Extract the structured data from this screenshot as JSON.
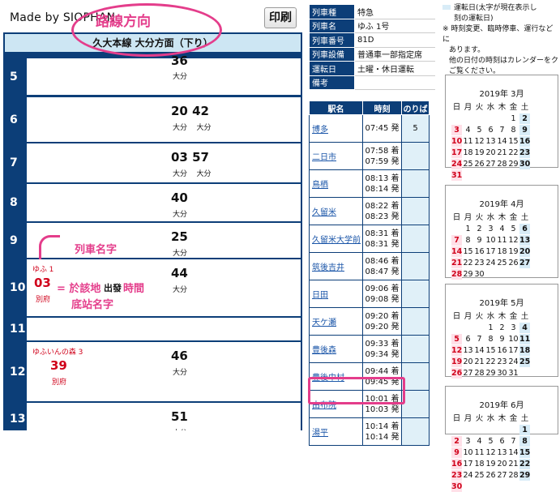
{
  "header": {
    "madeby": "Made by SIOPHAN",
    "print_label": "印刷",
    "annotation_title": "路線方向"
  },
  "timetable": {
    "title": "久大本線 大分方面（下り）",
    "rows": [
      {
        "hour": "5",
        "right_min": "36",
        "right_dst": "大分"
      },
      {
        "hour": "6",
        "right_min": "20  42",
        "right_dst": "大分    大分"
      },
      {
        "hour": "7",
        "right_min": "03  57",
        "right_dst": "大分    大分"
      },
      {
        "hour": "8",
        "right_min": "40",
        "right_dst": "大分"
      },
      {
        "hour": "9",
        "right_min": "25",
        "right_dst": "大分"
      },
      {
        "hour": "10",
        "right_min": "44",
        "right_dst": "大分",
        "train": "ゆふ 1",
        "tmin": "03",
        "tdst": "別府"
      },
      {
        "hour": "11",
        "right_min": "",
        "right_dst": ""
      },
      {
        "hour": "12",
        "right_min": "46",
        "right_dst": "大分",
        "train": "ゆふいんの森 3",
        "tmin": "39",
        "tdst": "別府"
      },
      {
        "hour": "13",
        "right_min": "51",
        "right_dst": "大分"
      }
    ],
    "annotations": {
      "train_name": "列車名字",
      "eq": "= 於該地",
      "dep_word": "出發",
      "time_word": "時間",
      "dest_name": "底站名字"
    }
  },
  "info": {
    "rows": [
      {
        "k": "列車種",
        "v": "特急"
      },
      {
        "k": "列車名",
        "v": "ゆふ 1号"
      },
      {
        "k": "列車番号",
        "v": "81D"
      },
      {
        "k": "列車設備",
        "v": "普通車一部指定席"
      },
      {
        "k": "運転日",
        "v": "土曜・休日運転"
      },
      {
        "k": "備考",
        "v": ""
      }
    ]
  },
  "stations": {
    "headers": [
      "駅名",
      "時刻",
      "のりば"
    ],
    "rows": [
      {
        "name": "博多",
        "t1": "",
        "t2": "07:45 発",
        "plat": "5"
      },
      {
        "name": "二日市",
        "t1": "07:58 着",
        "t2": "07:59 発",
        "plat": ""
      },
      {
        "name": "鳥栖",
        "t1": "08:13 着",
        "t2": "08:14 発",
        "plat": ""
      },
      {
        "name": "久留米",
        "t1": "08:22 着",
        "t2": "08:23 発",
        "plat": ""
      },
      {
        "name": "久留米大学前",
        "t1": "08:31 着",
        "t2": "08:31 発",
        "plat": ""
      },
      {
        "name": "筑後吉井",
        "t1": "08:46 着",
        "t2": "08:47 発",
        "plat": ""
      },
      {
        "name": "日田",
        "t1": "09:06 着",
        "t2": "09:08 発",
        "plat": ""
      },
      {
        "name": "天ケ瀬",
        "t1": "09:20 着",
        "t2": "09:20 発",
        "plat": ""
      },
      {
        "name": "豊後森",
        "t1": "09:33 着",
        "t2": "09:34 発",
        "plat": ""
      },
      {
        "name": "豊後中村",
        "t1": "09:44 着",
        "t2": "09:45 発",
        "plat": ""
      },
      {
        "name": "由布院",
        "t1": "10:01 着",
        "t2": "10:03 発",
        "plat": ""
      },
      {
        "name": "湯平",
        "t1": "10:14 着",
        "t2": "10:14 発",
        "plat": ""
      }
    ]
  },
  "note": {
    "legend": "運転日(太字が現在表示し",
    "legend2": "刻の運転日)",
    "lines": [
      "※ 時刻変更、臨時停車、運行などに",
      "  あります。",
      "  他の日付の時刻はカレンダーをク",
      "  ご覧ください。"
    ]
  },
  "calendars": [
    {
      "title": "2019年 3月"
    },
    {
      "title": "2019年 4月"
    },
    {
      "title": "2019年 5月"
    },
    {
      "title": "2019年 6月"
    }
  ],
  "weekdays": [
    "日",
    "月",
    "火",
    "水",
    "木",
    "金",
    "土"
  ]
}
